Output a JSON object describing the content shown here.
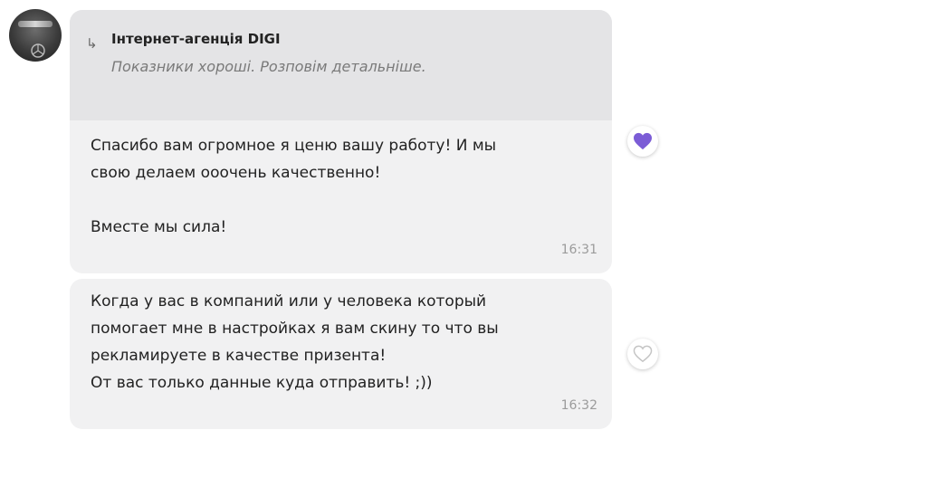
{
  "messages": [
    {
      "reply": {
        "author": "Інтернет-агенція DIGI",
        "text": "Показники хороші. Розповім детальніше."
      },
      "text": "Спасибо вам огромное я ценю вашу работу!  И мы\nсвою делаем ооочень качественно!\n\nВместе мы сила!",
      "time": "16:31",
      "reaction": {
        "icon": "heart-filled-icon",
        "color": "#7b5cd6",
        "liked": true
      }
    },
    {
      "text": "Когда у вас в компаний или у человека который\nпомогает мне в настройках я вам скину то что вы\nрекламируете в качестве призента!\nОт вас только данные куда отправить!   ;))",
      "time": "16:32",
      "reaction": {
        "icon": "heart-outline-icon",
        "color": "#c8c8c8",
        "liked": false
      }
    }
  ],
  "avatar": {
    "icon": "car-emblem-avatar"
  }
}
